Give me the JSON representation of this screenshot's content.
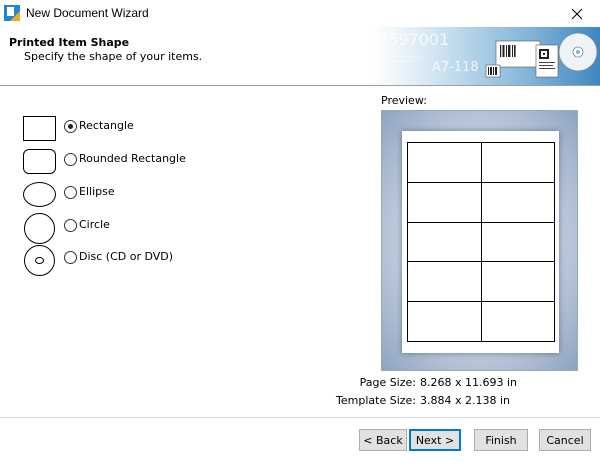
{
  "window": {
    "title": "New Document Wizard",
    "close_glyph": "✕"
  },
  "header": {
    "title": "Printed Item Shape",
    "subtitle": "Specify the shape of your items.",
    "banner_numbers": [
      "3597001",
      "A7-118"
    ]
  },
  "shapes": {
    "selected": "Rectangle",
    "options": [
      {
        "label": "Rectangle",
        "icon": "rectangle-shape-icon",
        "checked": true
      },
      {
        "label": "Rounded Rectangle",
        "icon": "rounded-rectangle-shape-icon",
        "checked": false
      },
      {
        "label": "Ellipse",
        "icon": "ellipse-shape-icon",
        "checked": false
      },
      {
        "label": "Circle",
        "icon": "circle-shape-icon",
        "checked": false
      },
      {
        "label": "Disc (CD or DVD)",
        "icon": "disc-shape-icon",
        "checked": false
      }
    ]
  },
  "preview": {
    "label": "Preview:",
    "grid": {
      "columns": 2,
      "rows": 5
    },
    "page_size_label": "Page Size:",
    "page_size_value": "8.268 x 11.693 in",
    "template_size_label": "Template Size:",
    "template_size_value": "3.884 x 2.138 in"
  },
  "buttons": {
    "back": "< Back",
    "next": "Next >",
    "finish": "Finish",
    "cancel": "Cancel"
  },
  "colors": {
    "accent": "#0078d7",
    "button_bg": "#e1e1e1",
    "preview_bg": "#c4d0e0"
  }
}
